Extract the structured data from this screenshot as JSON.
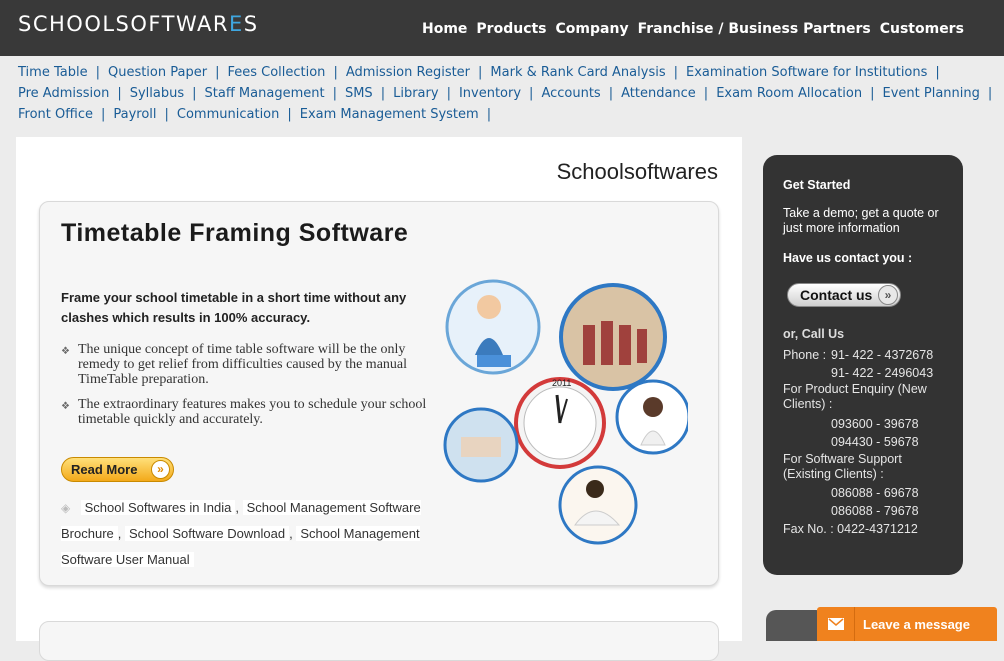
{
  "header": {
    "logo_main": "SCHOOLSOFTWAR",
    "logo_accent": "E",
    "logo_end": "S",
    "nav": [
      "Home",
      "Products",
      "Company",
      "Franchise / Business Partners",
      "Customers"
    ]
  },
  "subnav": {
    "row1": [
      "Time Table",
      "Question Paper",
      "Fees Collection",
      "Admission Register",
      "Mark & Rank Card Analysis",
      "Examination Software for Institutions"
    ],
    "row2": [
      "Pre Admission",
      "Syllabus",
      "Staff Management",
      "SMS",
      "Library",
      "Inventory",
      "Accounts",
      "Attendance",
      "Exam Room Allocation",
      "Event Planning"
    ],
    "row3": [
      "Front Office",
      "Payroll",
      "Communication",
      "Exam Management System"
    ],
    "separator": "|"
  },
  "main": {
    "site_name": "Schoolsoftwares",
    "card": {
      "title": "Timetable Framing Software",
      "intro": "Frame your school timetable in a short time without any clashes which results in 100% accuracy.",
      "bullets": [
        "The unique concept of time table software will be the only remedy to get relief from difficulties caused by the manual TimeTable preparation.",
        "The extraordinary features makes you to schedule your school timetable quickly and accurately."
      ],
      "read_more": "Read More",
      "tags": [
        "School Softwares in India",
        "School Management Software Brochure",
        "School Software Download",
        "School Management Software User Manual"
      ],
      "clock_year": "2011"
    }
  },
  "sidebar": {
    "get_started": "Get Started",
    "take_demo": "Take a demo; get a quote or just more information",
    "have_us": "Have us contact you :",
    "contact_button": "Contact us",
    "or_call": "or, Call Us",
    "phone_label": "Phone :",
    "phone1": "91- 422 - 4372678",
    "phone2": "91- 422 - 2496043",
    "enquiry_label": "For Product Enquiry (New Clients) :",
    "enquiry1": "093600 - 39678",
    "enquiry2": "094430 - 59678",
    "support_label": "For Software Support (Existing Clients) :",
    "support1": "086088 - 69678",
    "support2": "086088 - 79678",
    "fax": "Fax No. : 0422-4371212"
  },
  "chat": {
    "label": "Leave a message"
  },
  "colors": {
    "topbar": "#393939",
    "link_blue": "#1a5c96",
    "logo_accent": "#3fa6df",
    "orange": "#f0821e"
  }
}
